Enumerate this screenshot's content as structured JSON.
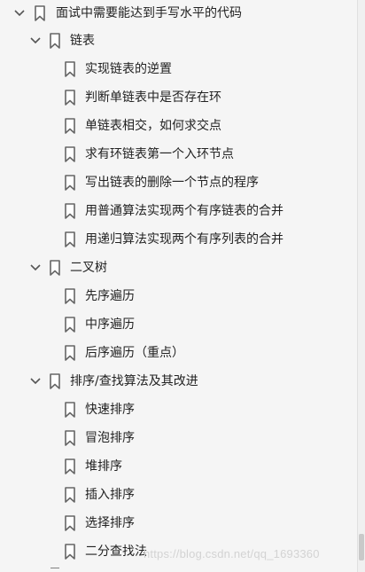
{
  "tree": {
    "root": {
      "label": "面试中需要能达到手写水平的代码",
      "expanded": true
    },
    "groups": [
      {
        "label": "链表",
        "expanded": true,
        "items": [
          "实现链表的逆置",
          "判断单链表中是否存在环",
          "单链表相交，如何求交点",
          "求有环链表第一个入环节点",
          "写出链表的删除一个节点的程序",
          "用普通算法实现两个有序链表的合并",
          "用递归算法实现两个有序列表的合并"
        ]
      },
      {
        "label": "二叉树",
        "expanded": true,
        "items": [
          "先序遍历",
          "中序遍历",
          "后序遍历（重点）"
        ]
      },
      {
        "label": "排序/查找算法及其改进",
        "expanded": true,
        "items": [
          "快速排序",
          "冒泡排序",
          "堆排序",
          "插入排序",
          "选择排序",
          "二分查找法"
        ]
      }
    ]
  },
  "watermark": "https://blog.csdn.net/qq_1693360",
  "icons": {
    "chevron": "chevron-down-icon",
    "bookmark": "bookmark-icon"
  },
  "colors": {
    "background": "#f5f5f5",
    "text": "#222222",
    "icon": "#666666"
  }
}
